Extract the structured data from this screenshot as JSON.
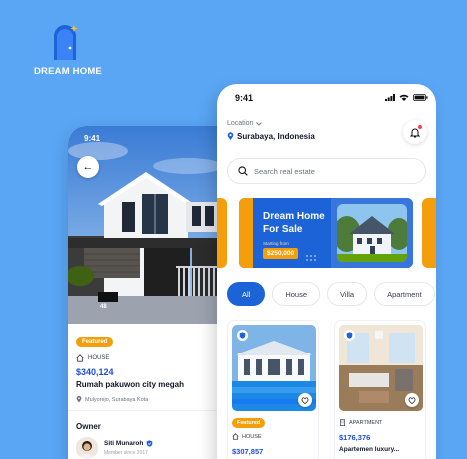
{
  "brand": {
    "name": "DREAM HOME"
  },
  "detail_screen": {
    "time": "9:41",
    "badge": "Featured",
    "type": "HOUSE",
    "price": "$340,124",
    "title": "Rumah pakuwon city megah",
    "address": "Mulyorejo, Surabaya Kota",
    "house_number": "48",
    "owner_label": "Owner",
    "owner_name": "Siti Munaroh",
    "owner_sub": "Member since 2017"
  },
  "home_screen": {
    "time": "9:41",
    "location_label": "Location",
    "location_value": "Surabaya, Indonesia",
    "search_placeholder": "Search real estate",
    "banner": {
      "title": "Dream Home For Sale",
      "subtitle": "Starting from",
      "price": "$250,000"
    },
    "filters": [
      "All",
      "House",
      "Villa",
      "Apartment"
    ],
    "cards": [
      {
        "badge": "Featured",
        "type": "HOUSE",
        "price": "$307,857",
        "name": ""
      },
      {
        "badge": "",
        "type": "APARTMENT",
        "price": "$176,376",
        "name": "Apartemen luxury..."
      }
    ]
  },
  "colors": {
    "background": "#5aa6f5",
    "primary": "#1d63d8",
    "accent": "#f59e0b"
  }
}
